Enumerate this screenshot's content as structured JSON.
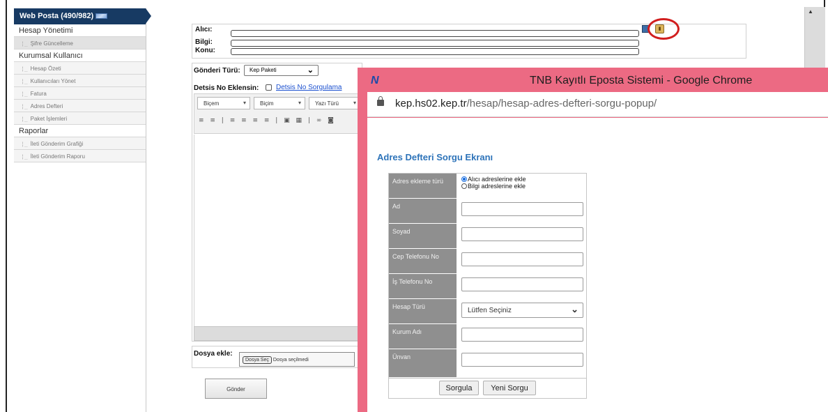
{
  "sidebar": {
    "header": "Web Posta (490/982)",
    "sections": [
      {
        "label": "Hesap Yönetimi",
        "items": [
          "Şifre Güncelleme"
        ]
      },
      {
        "label": "Kurumsal Kullanıcı",
        "items": [
          "Hesap Özeti",
          "Kullanıcıları Yönet",
          "Fatura",
          "Adres Defteri",
          "Paket İşlemleri"
        ]
      },
      {
        "label": "Raporlar",
        "items": [
          "İleti Gönderim Grafiği",
          "İleti Gönderim Raporu"
        ]
      }
    ]
  },
  "mail": {
    "alici_label": "Alıcı:",
    "bilgi_label": "Bilgi:",
    "konu_label": "Konu:",
    "gonderi_label": "Gönderi Türü:",
    "gonderi_value": "Kep Paketi",
    "detsis_label": "Detsis No Eklensin:",
    "detsis_link": "Detsis No Sorgulama",
    "toolbar": {
      "bicem": "Biçem",
      "bicim": "Biçim",
      "yazi_turu": "Yazı Türü"
    },
    "dosya_label": "Dosya ekle:",
    "file_button": "Dosya Seç",
    "file_status": "Dosya seçilmedi",
    "send_button": "Gönder"
  },
  "popup": {
    "title": "TNB Kayıtlı Eposta Sistemi - Google Chrome",
    "url_host": "kep.hs02.kep.tr",
    "url_path": "/hesap/hesap-adres-defteri-sorgu-popup/",
    "form_title": "Adres Defteri Sorgu Ekranı",
    "adres_turu_label": "Adres ekleme türü",
    "radio_alici": "Alıcı adreslerine ekle",
    "radio_bilgi": "Bilgi adreslerine ekle",
    "fields": {
      "ad": "Ad",
      "soyad": "Soyad",
      "cep": "Cep Telefonu No",
      "is": "İş Telefonu No",
      "hesap_turu": "Hesap Türü",
      "kurum": "Kurum Adı",
      "unvan": "Ünvan"
    },
    "hesap_turu_value": "Lütfen Seçiniz",
    "btn_sorgula": "Sorgula",
    "btn_yeni": "Yeni Sorgu"
  }
}
